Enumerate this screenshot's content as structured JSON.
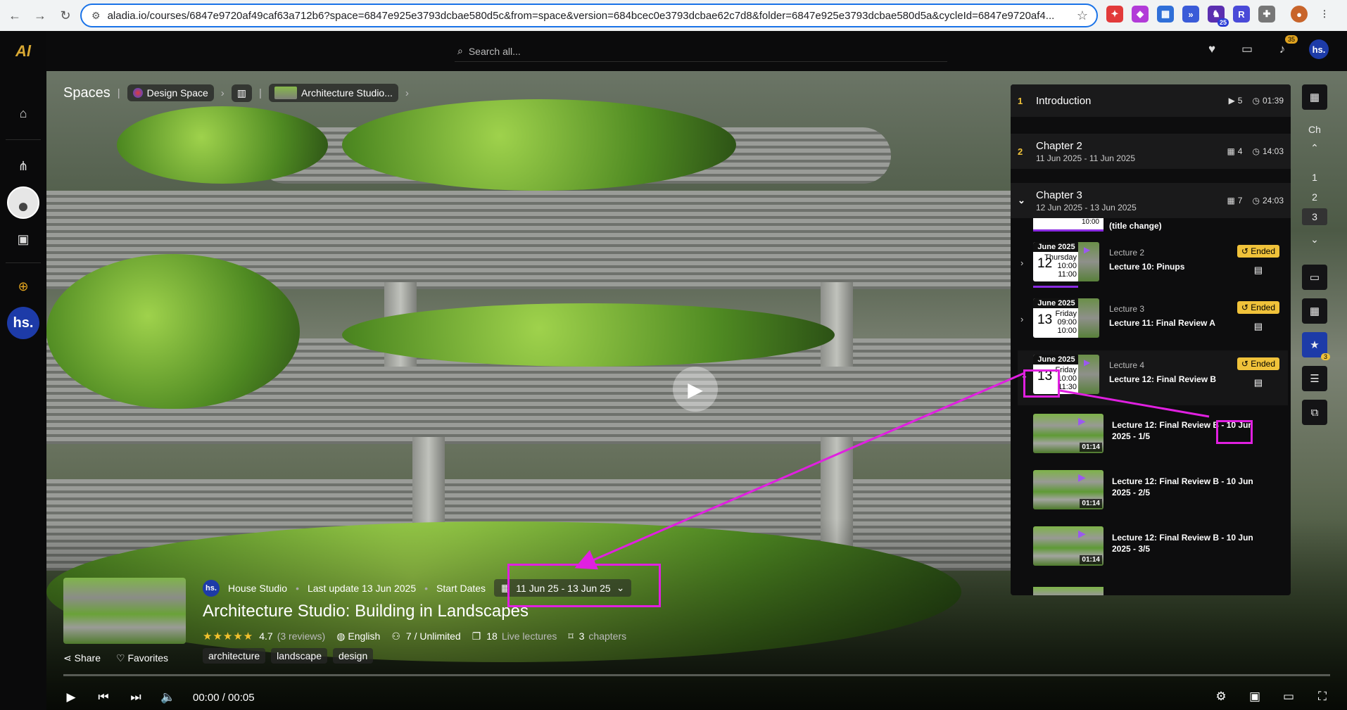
{
  "browser": {
    "url": "aladia.io/courses/6847e9720af49caf63a712b6?space=6847e925e3793dcbae580d5c&from=space&version=684bcec0e3793dcbae62c7d8&folder=6847e925e3793dcbae580d5a&cycleId=6847e9720af4...",
    "extension_badge": "25"
  },
  "topbar": {
    "search_placeholder": "Search all...",
    "notifications_count": "35",
    "user_initials": "hs."
  },
  "sidebar": {
    "user_initials": "hs."
  },
  "breadcrumb": {
    "root": "Spaces",
    "space": "Design Space",
    "course": "Architecture Studio..."
  },
  "course": {
    "author_initials": "hs.",
    "author": "House Studio",
    "last_update": "Last update 13 Jun 2025",
    "start_dates_label": "Start Dates",
    "date_range": "11 Jun 25 - 13 Jun 25",
    "title": "Architecture Studio: Building in Landscapes",
    "stars": "★★★★★",
    "rating": "4.7",
    "reviews": "(3 reviews)",
    "language": "English",
    "seats": "7 / Unlimited",
    "lectures_count": "18",
    "lectures_label": "Live lectures",
    "chapters_count": "3",
    "chapters_label": "chapters",
    "share_label": "Share",
    "favorites_label": "Favorites",
    "tags": [
      "architecture",
      "landscape",
      "design"
    ]
  },
  "player": {
    "time": "00:00 / 00:05",
    "progress": 0.0
  },
  "chapters": [
    {
      "num": "1",
      "title": "Introduction",
      "dates": "",
      "count": "5",
      "duration": "01:39"
    },
    {
      "num": "2",
      "title": "Chapter 2",
      "dates": "11 Jun 2025 - 11 Jun 2025",
      "count": "4",
      "duration": "14:03"
    },
    {
      "num": "",
      "title": "Chapter 3",
      "dates": "12 Jun 2025 - 13 Jun 2025",
      "count": "7",
      "duration": "24:03"
    }
  ],
  "partial_item": {
    "time": "10:00",
    "name": "(title change)"
  },
  "lectures": [
    {
      "month": "June 2025",
      "day": "12",
      "dow": "Thursday",
      "start": "10:00",
      "end": "11:00",
      "label": "Lecture 2",
      "name": "Lecture 10: Pinups",
      "status": "Ended"
    },
    {
      "month": "June 2025",
      "day": "13",
      "dow": "Friday",
      "start": "09:00",
      "end": "10:00",
      "label": "Lecture 3",
      "name": "Lecture 11: Final Review A",
      "status": "Ended"
    },
    {
      "month": "June 2025",
      "day": "13",
      "dow": "Friday",
      "start": "10:00",
      "end": "11:30",
      "label": "Lecture 4",
      "name": "Lecture 12: Final Review B",
      "status": "Ended"
    }
  ],
  "recordings": [
    {
      "name": "Lecture 12: Final Review B - 10 Jun 2025 - 1/5",
      "duration": "01:14"
    },
    {
      "name": "Lecture 12: Final Review B - 10 Jun 2025 - 2/5",
      "duration": "01:14"
    },
    {
      "name": "Lecture 12: Final Review B - 10 Jun 2025 - 3/5",
      "duration": "01:14"
    }
  ],
  "rail": {
    "ch_label": "Ch",
    "nums": [
      "1",
      "2",
      "3"
    ],
    "favorites_count": "3"
  },
  "annotation_color": "#e020e0"
}
